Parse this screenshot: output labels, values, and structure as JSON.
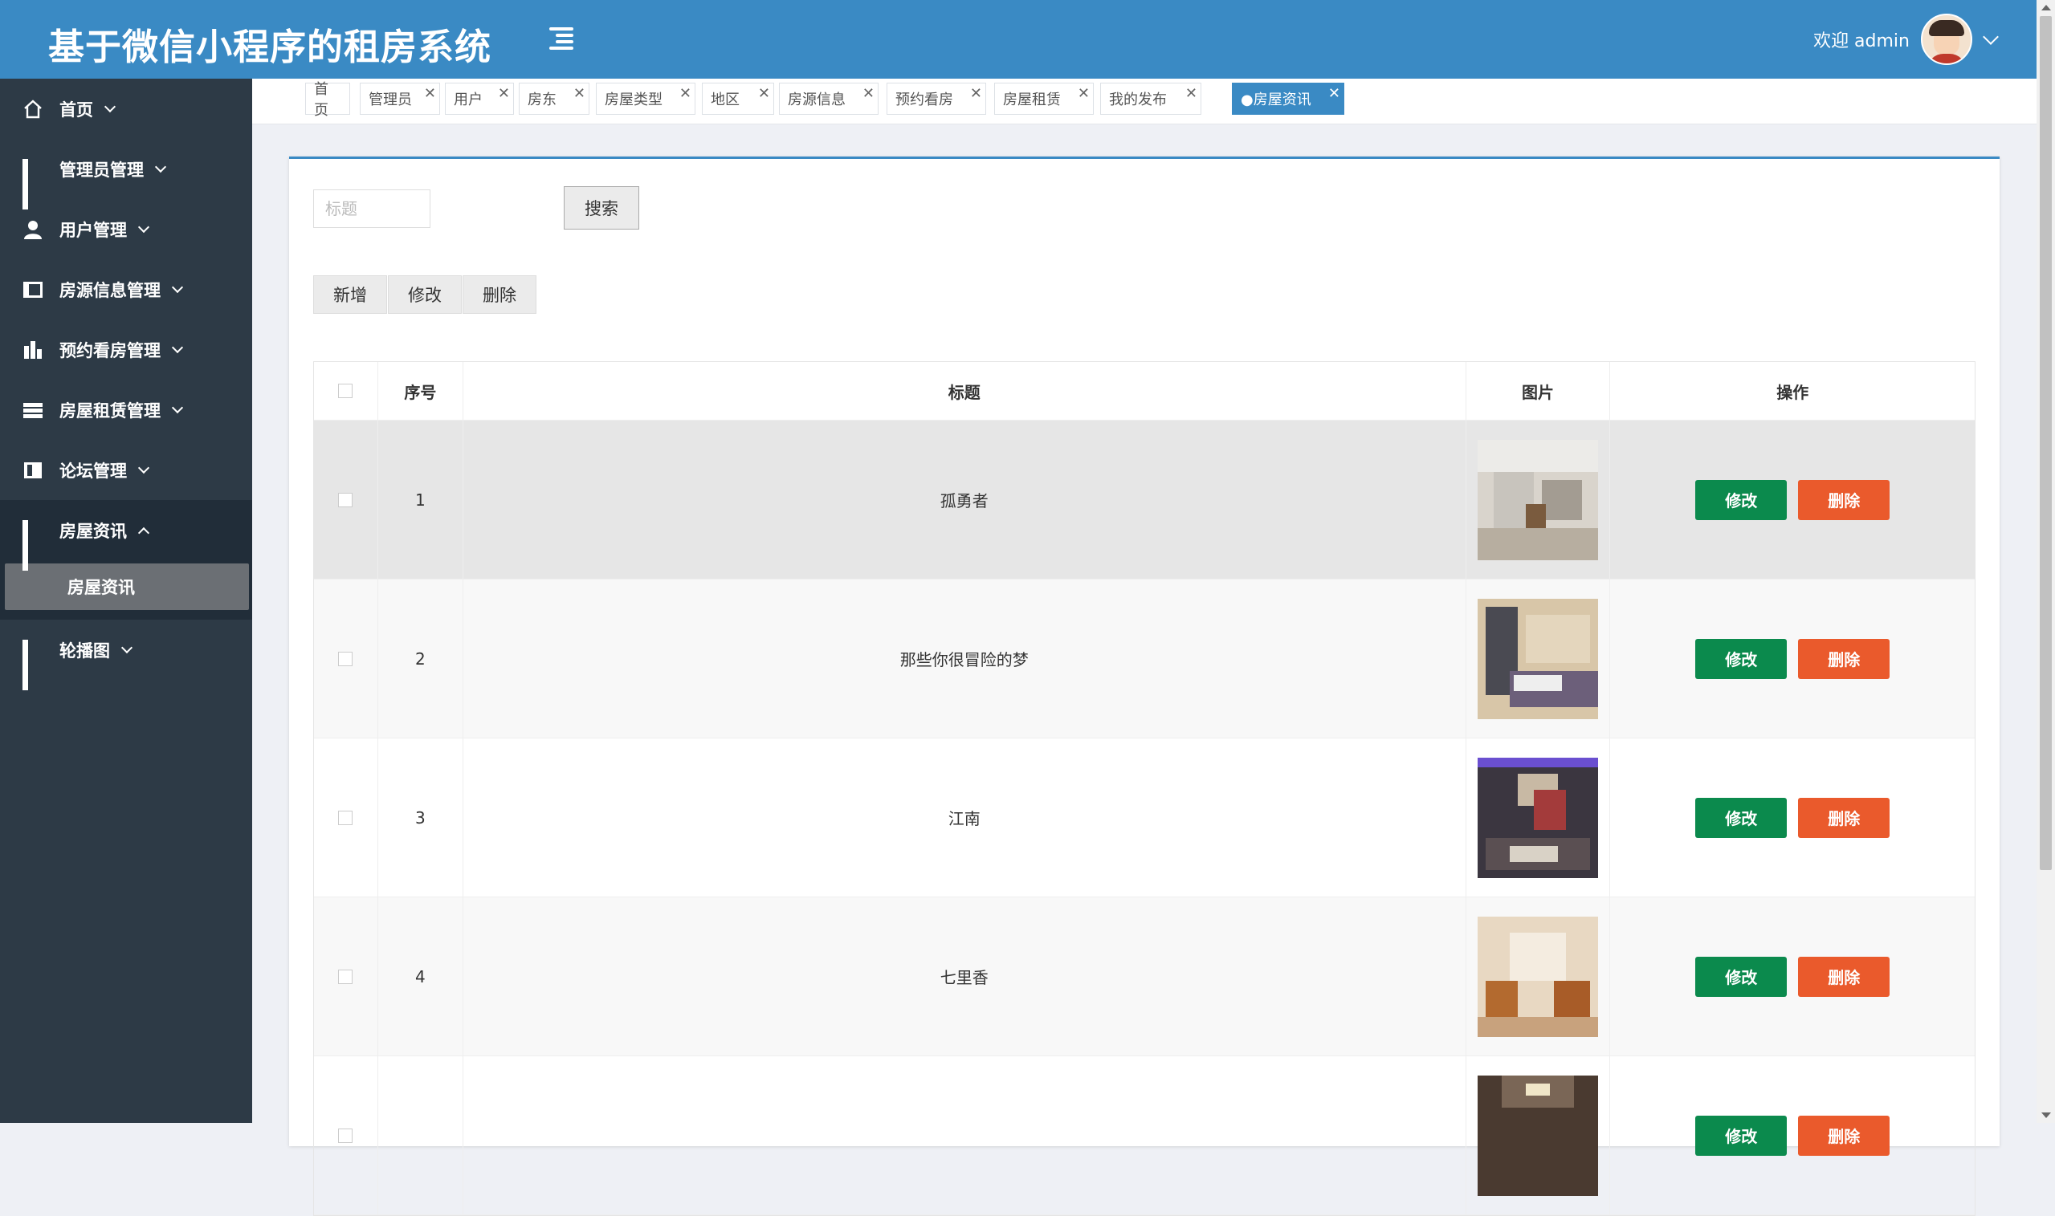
{
  "header": {
    "title": "基于微信小程序的租房系统",
    "welcome": "欢迎 admin"
  },
  "sidebar": {
    "items": [
      {
        "label": "首页",
        "icon": "home-icon"
      },
      {
        "label": "管理员管理",
        "icon": "grid-icon"
      },
      {
        "label": "用户管理",
        "icon": "user-icon"
      },
      {
        "label": "房源信息管理",
        "icon": "panel-icon"
      },
      {
        "label": "预约看房管理",
        "icon": "bank-icon"
      },
      {
        "label": "房屋租赁管理",
        "icon": "list-icon"
      },
      {
        "label": "论坛管理",
        "icon": "book-icon"
      },
      {
        "label": "房屋资讯",
        "icon": "grid-icon"
      },
      {
        "label": "轮播图",
        "icon": "grid-icon"
      }
    ],
    "submenu_label": "房屋资讯"
  },
  "tabs": [
    {
      "label": "首页"
    },
    {
      "label": "管理员"
    },
    {
      "label": "用户"
    },
    {
      "label": "房东"
    },
    {
      "label": "房屋类型"
    },
    {
      "label": "地区"
    },
    {
      "label": "房源信息"
    },
    {
      "label": "预约看房"
    },
    {
      "label": "房屋租赁"
    },
    {
      "label": "我的发布"
    },
    {
      "label": "●房屋资讯"
    }
  ],
  "search": {
    "placeholder": "标题",
    "button_label": "搜索"
  },
  "actions": {
    "add": "新增",
    "edit": "修改",
    "delete": "删除"
  },
  "table": {
    "headers": {
      "no": "序号",
      "title": "标题",
      "image": "图片",
      "ops": "操作"
    },
    "rows": [
      {
        "no": "1",
        "title": "孤勇者"
      },
      {
        "no": "2",
        "title": "那些你很冒险的梦"
      },
      {
        "no": "3",
        "title": "江南"
      },
      {
        "no": "4",
        "title": "七里香"
      }
    ],
    "row_edit": "修改",
    "row_delete": "删除"
  },
  "colors": {
    "header": "#3a8ac4",
    "sidebar": "#2d3a46",
    "edit": "#0b8a4d",
    "delete": "#ea5a2c"
  }
}
